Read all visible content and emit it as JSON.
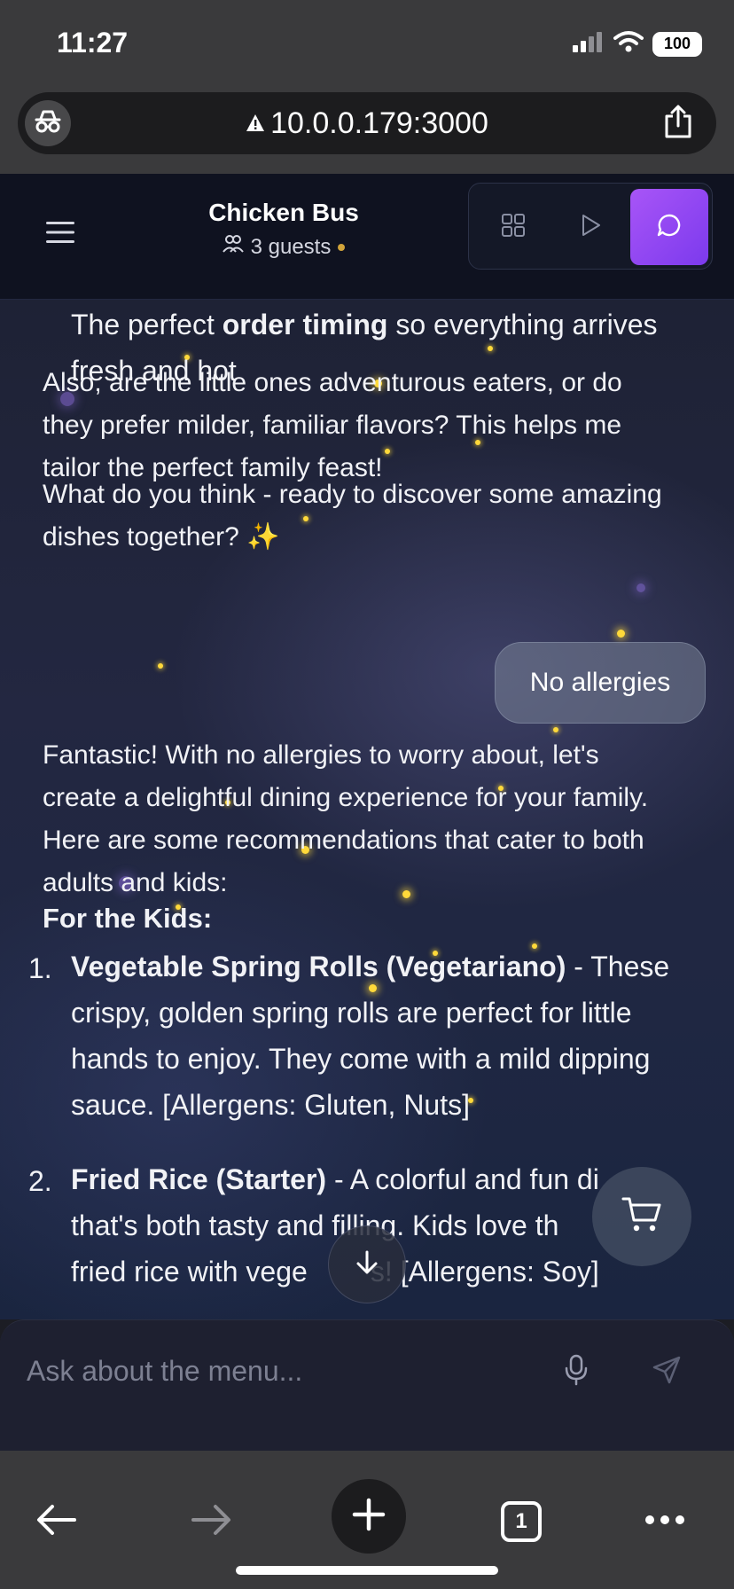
{
  "status_bar": {
    "time": "11:27",
    "battery": "100"
  },
  "browser": {
    "url": "10.0.0.179:3000",
    "tab_count": "1"
  },
  "header": {
    "title": "Chicken Bus",
    "guests": "3 guests"
  },
  "chat": {
    "p1": {
      "before": "The perfect ",
      "bold": "order timing",
      "after_line1": " so everything arrives",
      "line2": "fresh and hot"
    },
    "p2": [
      "Also, are the little ones adventurous eaters, or do",
      "they prefer milder, familiar flavors? This helps me",
      "tailor the perfect family feast!"
    ],
    "p3": [
      "What do you think - ready to discover some amazing",
      "dishes together? ✨"
    ],
    "user_message": "No allergies",
    "p4": [
      "Fantastic! With no allergies to worry about, let's",
      "create a delightful dining experience for your family.",
      "Here are some recommendations that cater to both",
      "adults and kids:"
    ],
    "section_heading": "For the Kids:",
    "items": [
      {
        "num": "1.",
        "title": "Vegetable Spring Rolls (Vegetariano)",
        "line1_rest": " - These",
        "line2": "crispy, golden spring rolls are perfect for little",
        "line3": "hands to enjoy. They come with a mild dipping",
        "line4": "sauce. [Allergens: Gluten, Nuts]"
      },
      {
        "num": "2.",
        "title": "Fried Rice (Starter)",
        "line1_rest": " - A colorful and fun di",
        "line2": "that's both tasty and filling. Kids love th",
        "line3": "fried rice with vege        s! [Allergens: Soy]"
      }
    ]
  },
  "input": {
    "placeholder": "Ask about the menu..."
  },
  "colors": {
    "accent": "#8b5cf6",
    "sparkle": "#ffd93a",
    "guest_dot": "#d1a43a"
  }
}
